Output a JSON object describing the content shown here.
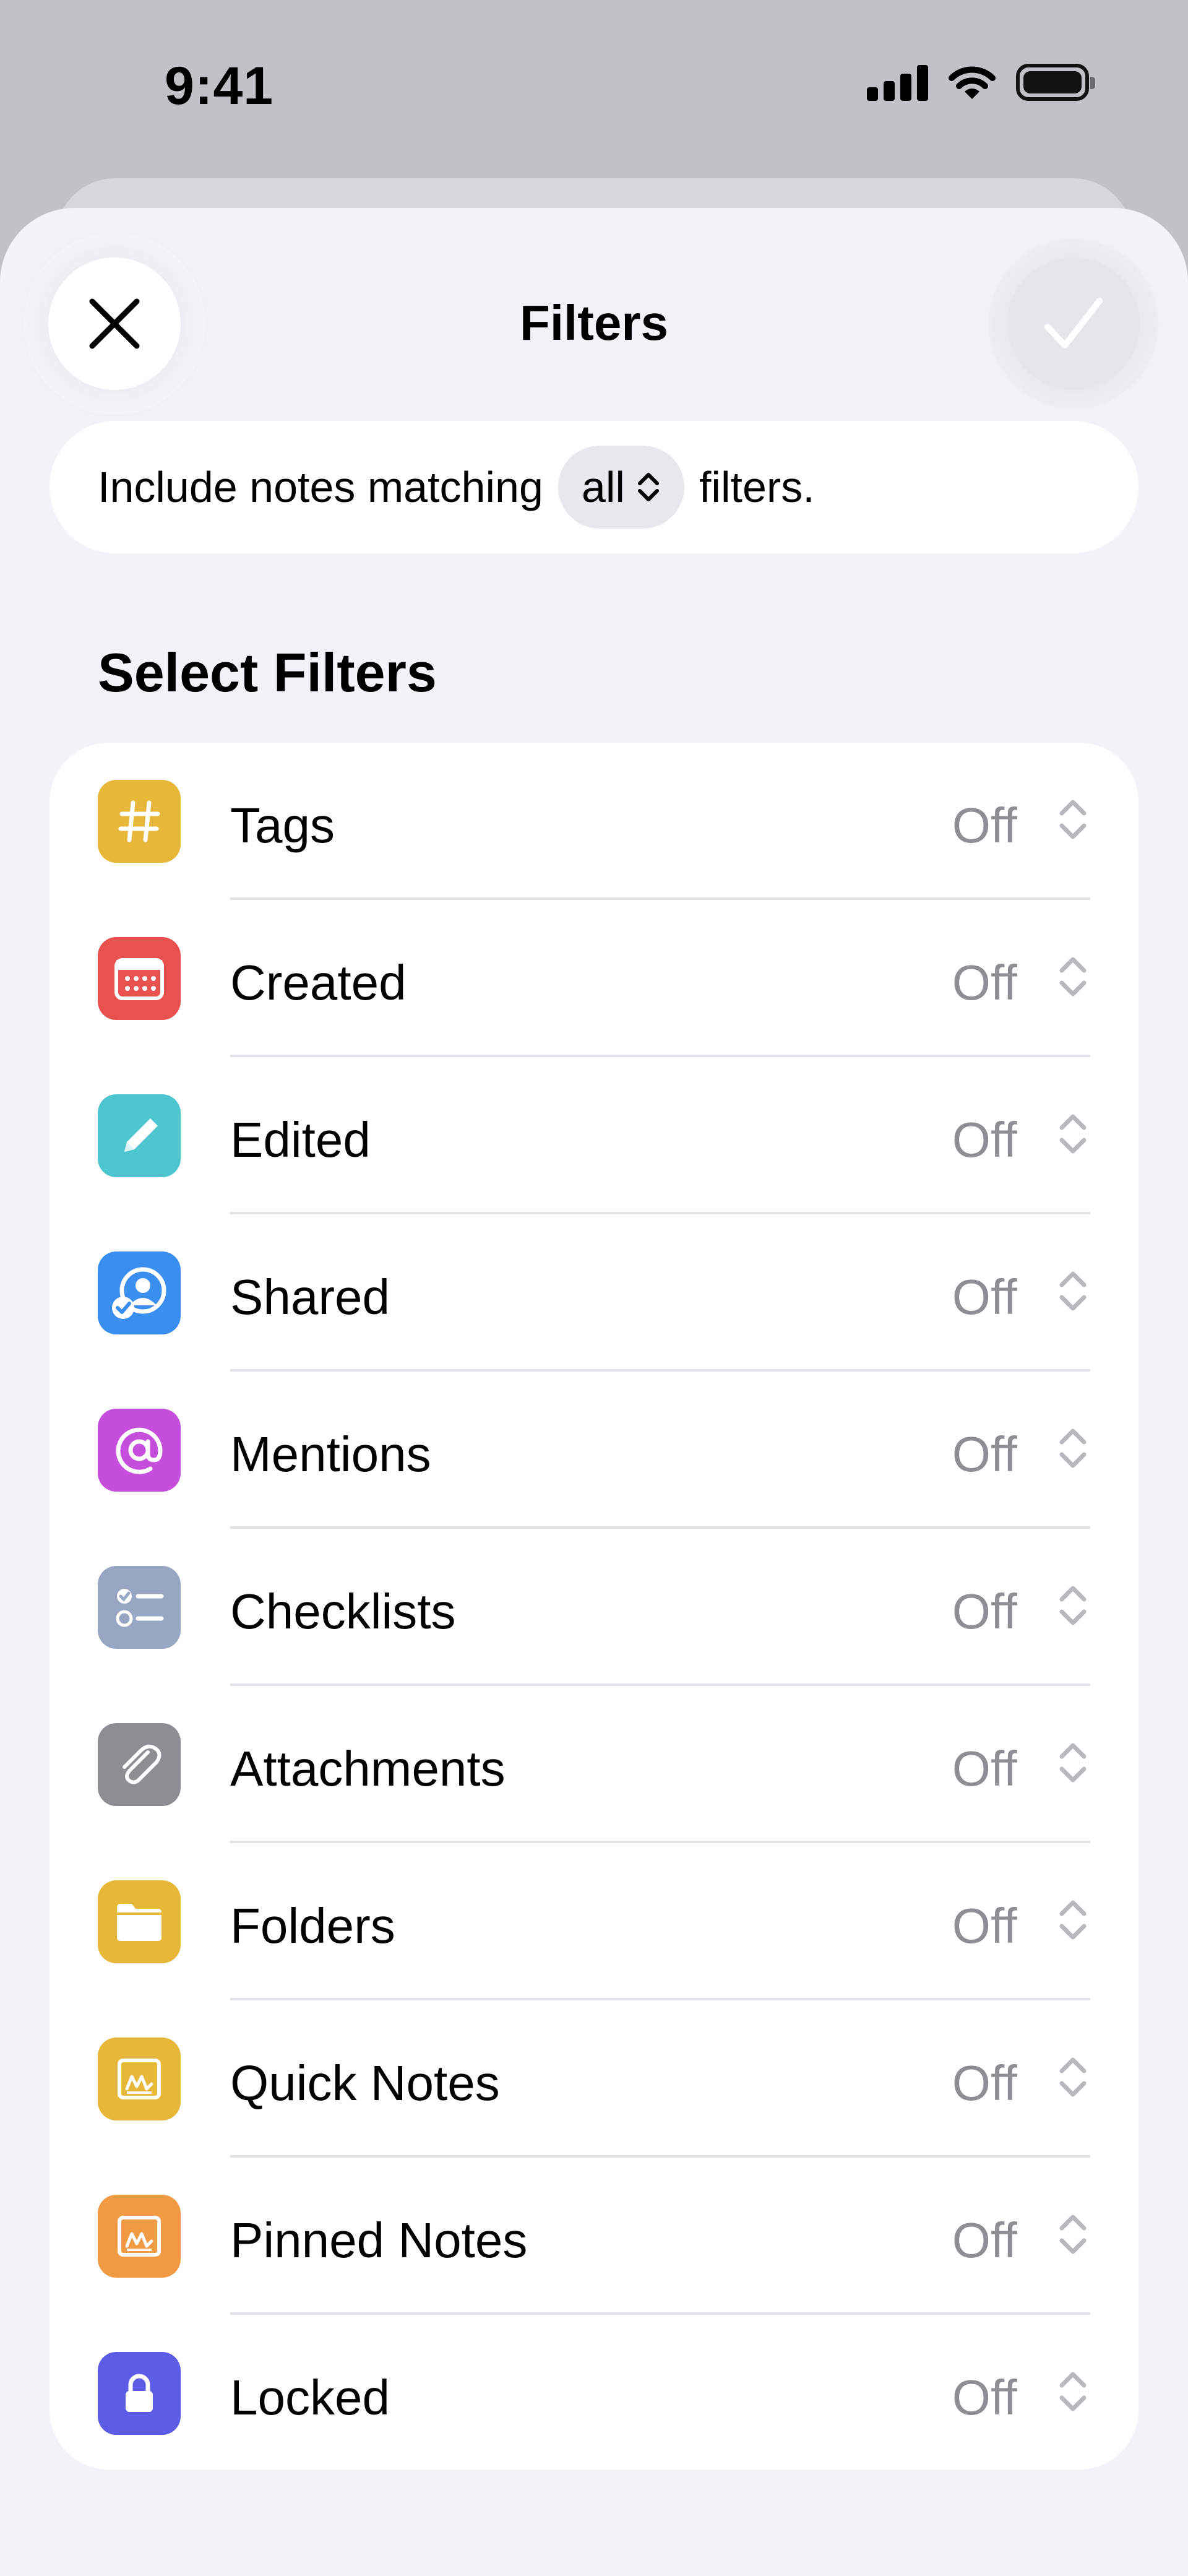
{
  "status_bar": {
    "time": "9:41"
  },
  "header": {
    "title": "Filters",
    "close_icon": "close-icon",
    "done_icon": "checkmark-icon"
  },
  "match": {
    "prefix": "Include notes matching",
    "selected": "all",
    "suffix": "filters."
  },
  "section_title": "Select Filters",
  "filters": [
    {
      "label": "Tags",
      "value": "Off",
      "icon": "hashtag-icon",
      "color": "#e7b73a"
    },
    {
      "label": "Created",
      "value": "Off",
      "icon": "calendar-icon",
      "color": "#e8514d"
    },
    {
      "label": "Edited",
      "value": "Off",
      "icon": "pencil-icon",
      "color": "#4ec6cf"
    },
    {
      "label": "Shared",
      "value": "Off",
      "icon": "shared-person-icon",
      "color": "#3a8ef0"
    },
    {
      "label": "Mentions",
      "value": "Off",
      "icon": "at-sign-icon",
      "color": "#c54fdc"
    },
    {
      "label": "Checklists",
      "value": "Off",
      "icon": "checklist-icon",
      "color": "#97a7c3"
    },
    {
      "label": "Attachments",
      "value": "Off",
      "icon": "paperclip-icon",
      "color": "#8d8d92"
    },
    {
      "label": "Folders",
      "value": "Off",
      "icon": "folder-icon",
      "color": "#e7b73a"
    },
    {
      "label": "Quick Notes",
      "value": "Off",
      "icon": "quick-note-icon",
      "color": "#e7b73a"
    },
    {
      "label": "Pinned Notes",
      "value": "Off",
      "icon": "pinned-note-icon",
      "color": "#f19a44"
    },
    {
      "label": "Locked",
      "value": "Off",
      "icon": "lock-icon",
      "color": "#5c5ce6"
    }
  ]
}
